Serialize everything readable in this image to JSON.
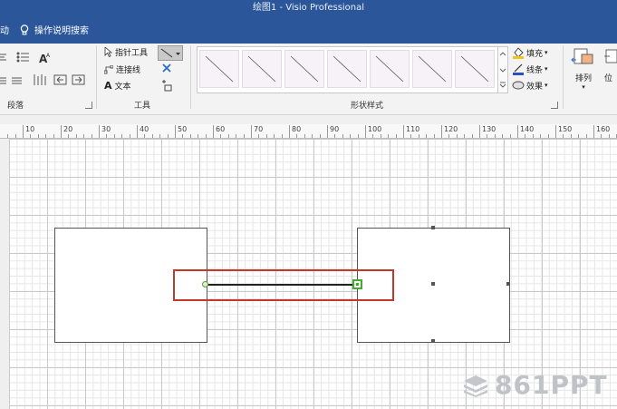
{
  "window": {
    "title": "绘图1  -  Visio Professional",
    "left_tab": "动",
    "tell_me": "操作说明搜索"
  },
  "ribbon": {
    "paragraph_group": "段落",
    "tools_group": {
      "label": "工具",
      "pointer": "指针工具",
      "connector": "连接线",
      "text": "文本"
    },
    "shape_styles_group": {
      "label": "形状样式",
      "fill": "填充",
      "line": "线条",
      "effects": "效果"
    },
    "arrange": {
      "label": "排列",
      "position": "位"
    }
  },
  "ruler": {
    "labels": [
      "10",
      "20",
      "30",
      "40",
      "50",
      "60",
      "70",
      "80",
      "90",
      "100",
      "110",
      "120",
      "130",
      "140",
      "150",
      "160"
    ]
  },
  "watermark": {
    "text": "861PPT"
  },
  "colors": {
    "titlebar": "#2b579a",
    "highlight": "#c0392b",
    "glue_point": "#3fae2a"
  }
}
